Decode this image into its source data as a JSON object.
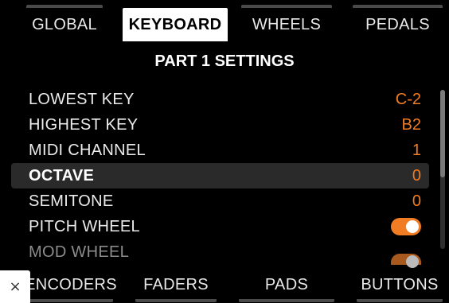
{
  "top_tabs": [
    {
      "label": "GLOBAL"
    },
    {
      "label": "KEYBOARD"
    },
    {
      "label": "WHEELS"
    },
    {
      "label": "PEDALS"
    }
  ],
  "active_tab": "KEYBOARD",
  "section_title": "PART 1 SETTINGS",
  "settings": [
    {
      "label": "LOWEST KEY",
      "value": "C-2"
    },
    {
      "label": "HIGHEST KEY",
      "value": "B2"
    },
    {
      "label": "MIDI CHANNEL",
      "value": "1"
    },
    {
      "label": "OCTAVE",
      "value": "0",
      "selected": true
    },
    {
      "label": "SEMITONE",
      "value": "0"
    },
    {
      "label": "PITCH WHEEL",
      "toggle": "on"
    },
    {
      "label": "MOD WHEEL",
      "toggle": "on"
    }
  ],
  "bottom_tabs": [
    {
      "label": "ENCODERS"
    },
    {
      "label": "FADERS"
    },
    {
      "label": "PADS"
    },
    {
      "label": "BUTTONS"
    }
  ],
  "close_glyph": "×",
  "colors": {
    "accent": "#f07d24",
    "background": "#000000",
    "active_tab_bg": "#ffffff",
    "selected_row_bg": "#2a2a2a"
  }
}
